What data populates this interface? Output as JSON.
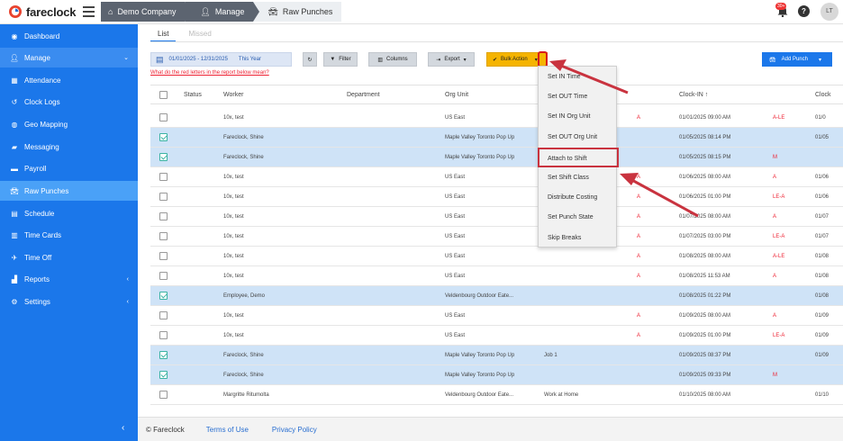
{
  "app": {
    "brand": "fareclock"
  },
  "breadcrumb": [
    "Demo Company",
    "Manage",
    "Raw Punches"
  ],
  "header": {
    "notif_badge": "30+",
    "help": "?",
    "avatar_initials": "LT"
  },
  "sidebar": {
    "items": [
      {
        "label": "Dashboard",
        "icon": "gauge-icon"
      },
      {
        "label": "Manage",
        "icon": "user-icon"
      },
      {
        "label": "Attendance",
        "icon": "attendance-icon"
      },
      {
        "label": "Clock Logs",
        "icon": "history-icon"
      },
      {
        "label": "Geo Mapping",
        "icon": "globe-icon"
      },
      {
        "label": "Messaging",
        "icon": "chat-icon"
      },
      {
        "label": "Payroll",
        "icon": "money-icon"
      },
      {
        "label": "Raw Punches",
        "icon": "car-icon"
      },
      {
        "label": "Schedule",
        "icon": "calendar-icon"
      },
      {
        "label": "Time Cards",
        "icon": "table-icon"
      },
      {
        "label": "Time Off",
        "icon": "plane-icon"
      },
      {
        "label": "Reports",
        "icon": "chart-icon"
      },
      {
        "label": "Settings",
        "icon": "gear-icon"
      }
    ]
  },
  "tabs": [
    "List",
    "Missed"
  ],
  "toolbar": {
    "date_range": "01/01/2025 - 12/31/2025",
    "range_label": "This Year",
    "filter": "Filter",
    "columns": "Columns",
    "export": "Export",
    "bulk_action": "Bulk Action",
    "add_punch": "Add Punch",
    "help_link": "What do the red letters in the report below mean?"
  },
  "table": {
    "columns": [
      "Status",
      "Worker",
      "Department",
      "Org Unit",
      "Clock-IN",
      "Clock"
    ],
    "rows": [
      {
        "checked": false,
        "worker": "10x, test",
        "org": "US East",
        "job": "",
        "flag": "A",
        "clockin": "01/01/2025 09:00 AM",
        "code": "A-LE",
        "clockout": "01/0"
      },
      {
        "checked": true,
        "worker": "Fareclock, Shine",
        "org": "Maple Valley Toronto Pop Up",
        "job": "",
        "flag": "",
        "clockin": "01/05/2025 08:14 PM",
        "code": "",
        "clockout": "01/05"
      },
      {
        "checked": true,
        "worker": "Fareclock, Shine",
        "org": "Maple Valley Toronto Pop Up",
        "job": "",
        "flag": "",
        "clockin": "01/05/2025 08:15 PM",
        "code": "M",
        "clockout": ""
      },
      {
        "checked": false,
        "worker": "10x, test",
        "org": "US East",
        "job": "",
        "flag": "A",
        "clockin": "01/06/2025 08:00 AM",
        "code": "A",
        "clockout": "01/06"
      },
      {
        "checked": false,
        "worker": "10x, test",
        "org": "US East",
        "job": "",
        "flag": "A",
        "clockin": "01/06/2025 01:00 PM",
        "code": "LE-A",
        "clockout": "01/06"
      },
      {
        "checked": false,
        "worker": "10x, test",
        "org": "US East",
        "job": "",
        "flag": "A",
        "clockin": "01/07/2025 08:00 AM",
        "code": "A",
        "clockout": "01/07"
      },
      {
        "checked": false,
        "worker": "10x, test",
        "org": "US East",
        "job": "",
        "flag": "A",
        "clockin": "01/07/2025 03:00 PM",
        "code": "LE-A",
        "clockout": "01/07"
      },
      {
        "checked": false,
        "worker": "10x, test",
        "org": "US East",
        "job": "",
        "flag": "A",
        "clockin": "01/08/2025 08:00 AM",
        "code": "A-LE",
        "clockout": "01/08"
      },
      {
        "checked": false,
        "worker": "10x, test",
        "org": "US East",
        "job": "",
        "flag": "A",
        "clockin": "01/08/2025 11:53 AM",
        "code": "A",
        "clockout": "01/08"
      },
      {
        "checked": true,
        "worker": "Employee, Demo",
        "org": "Veldenbourg Outdoor Eate...",
        "job": "",
        "flag": "",
        "clockin": "01/08/2025 01:22 PM",
        "code": "",
        "clockout": "01/08"
      },
      {
        "checked": false,
        "worker": "10x, test",
        "org": "US East",
        "job": "",
        "flag": "A",
        "clockin": "01/09/2025 08:00 AM",
        "code": "A",
        "clockout": "01/09"
      },
      {
        "checked": false,
        "worker": "10x, test",
        "org": "US East",
        "job": "",
        "flag": "A",
        "clockin": "01/09/2025 01:00 PM",
        "code": "LE-A",
        "clockout": "01/09"
      },
      {
        "checked": true,
        "worker": "Fareclock, Shine",
        "org": "Maple Valley Toronto Pop Up",
        "job": "Job 1",
        "flag": "",
        "clockin": "01/09/2025 08:37 PM",
        "code": "",
        "clockout": "01/09"
      },
      {
        "checked": true,
        "worker": "Fareclock, Shine",
        "org": "Maple Valley Toronto Pop Up",
        "job": "",
        "flag": "",
        "clockin": "01/09/2025 09:33 PM",
        "code": "M",
        "clockout": ""
      },
      {
        "checked": false,
        "worker": "Margritte Ritumolta",
        "org": "Veldenbourg Outdoor Eate...",
        "job": "Work at Home",
        "flag": "",
        "clockin": "01/10/2025 08:00 AM",
        "code": "",
        "clockout": "01/10"
      }
    ]
  },
  "bulk_menu": {
    "items": [
      "Set IN Time",
      "Set OUT Time",
      "Set IN Org Unit",
      "Set OUT Org Unit",
      "Attach to Shift",
      "Set Shift Class",
      "Distribute Costing",
      "Set Punch State",
      "Skip Breaks"
    ]
  },
  "footer": {
    "copyright": "© Fareclock",
    "terms": "Terms of Use",
    "privacy": "Privacy Policy"
  },
  "colors": {
    "sidebar": "#1b77ea",
    "accent": "#f5b400",
    "highlight": "#c9333f"
  }
}
